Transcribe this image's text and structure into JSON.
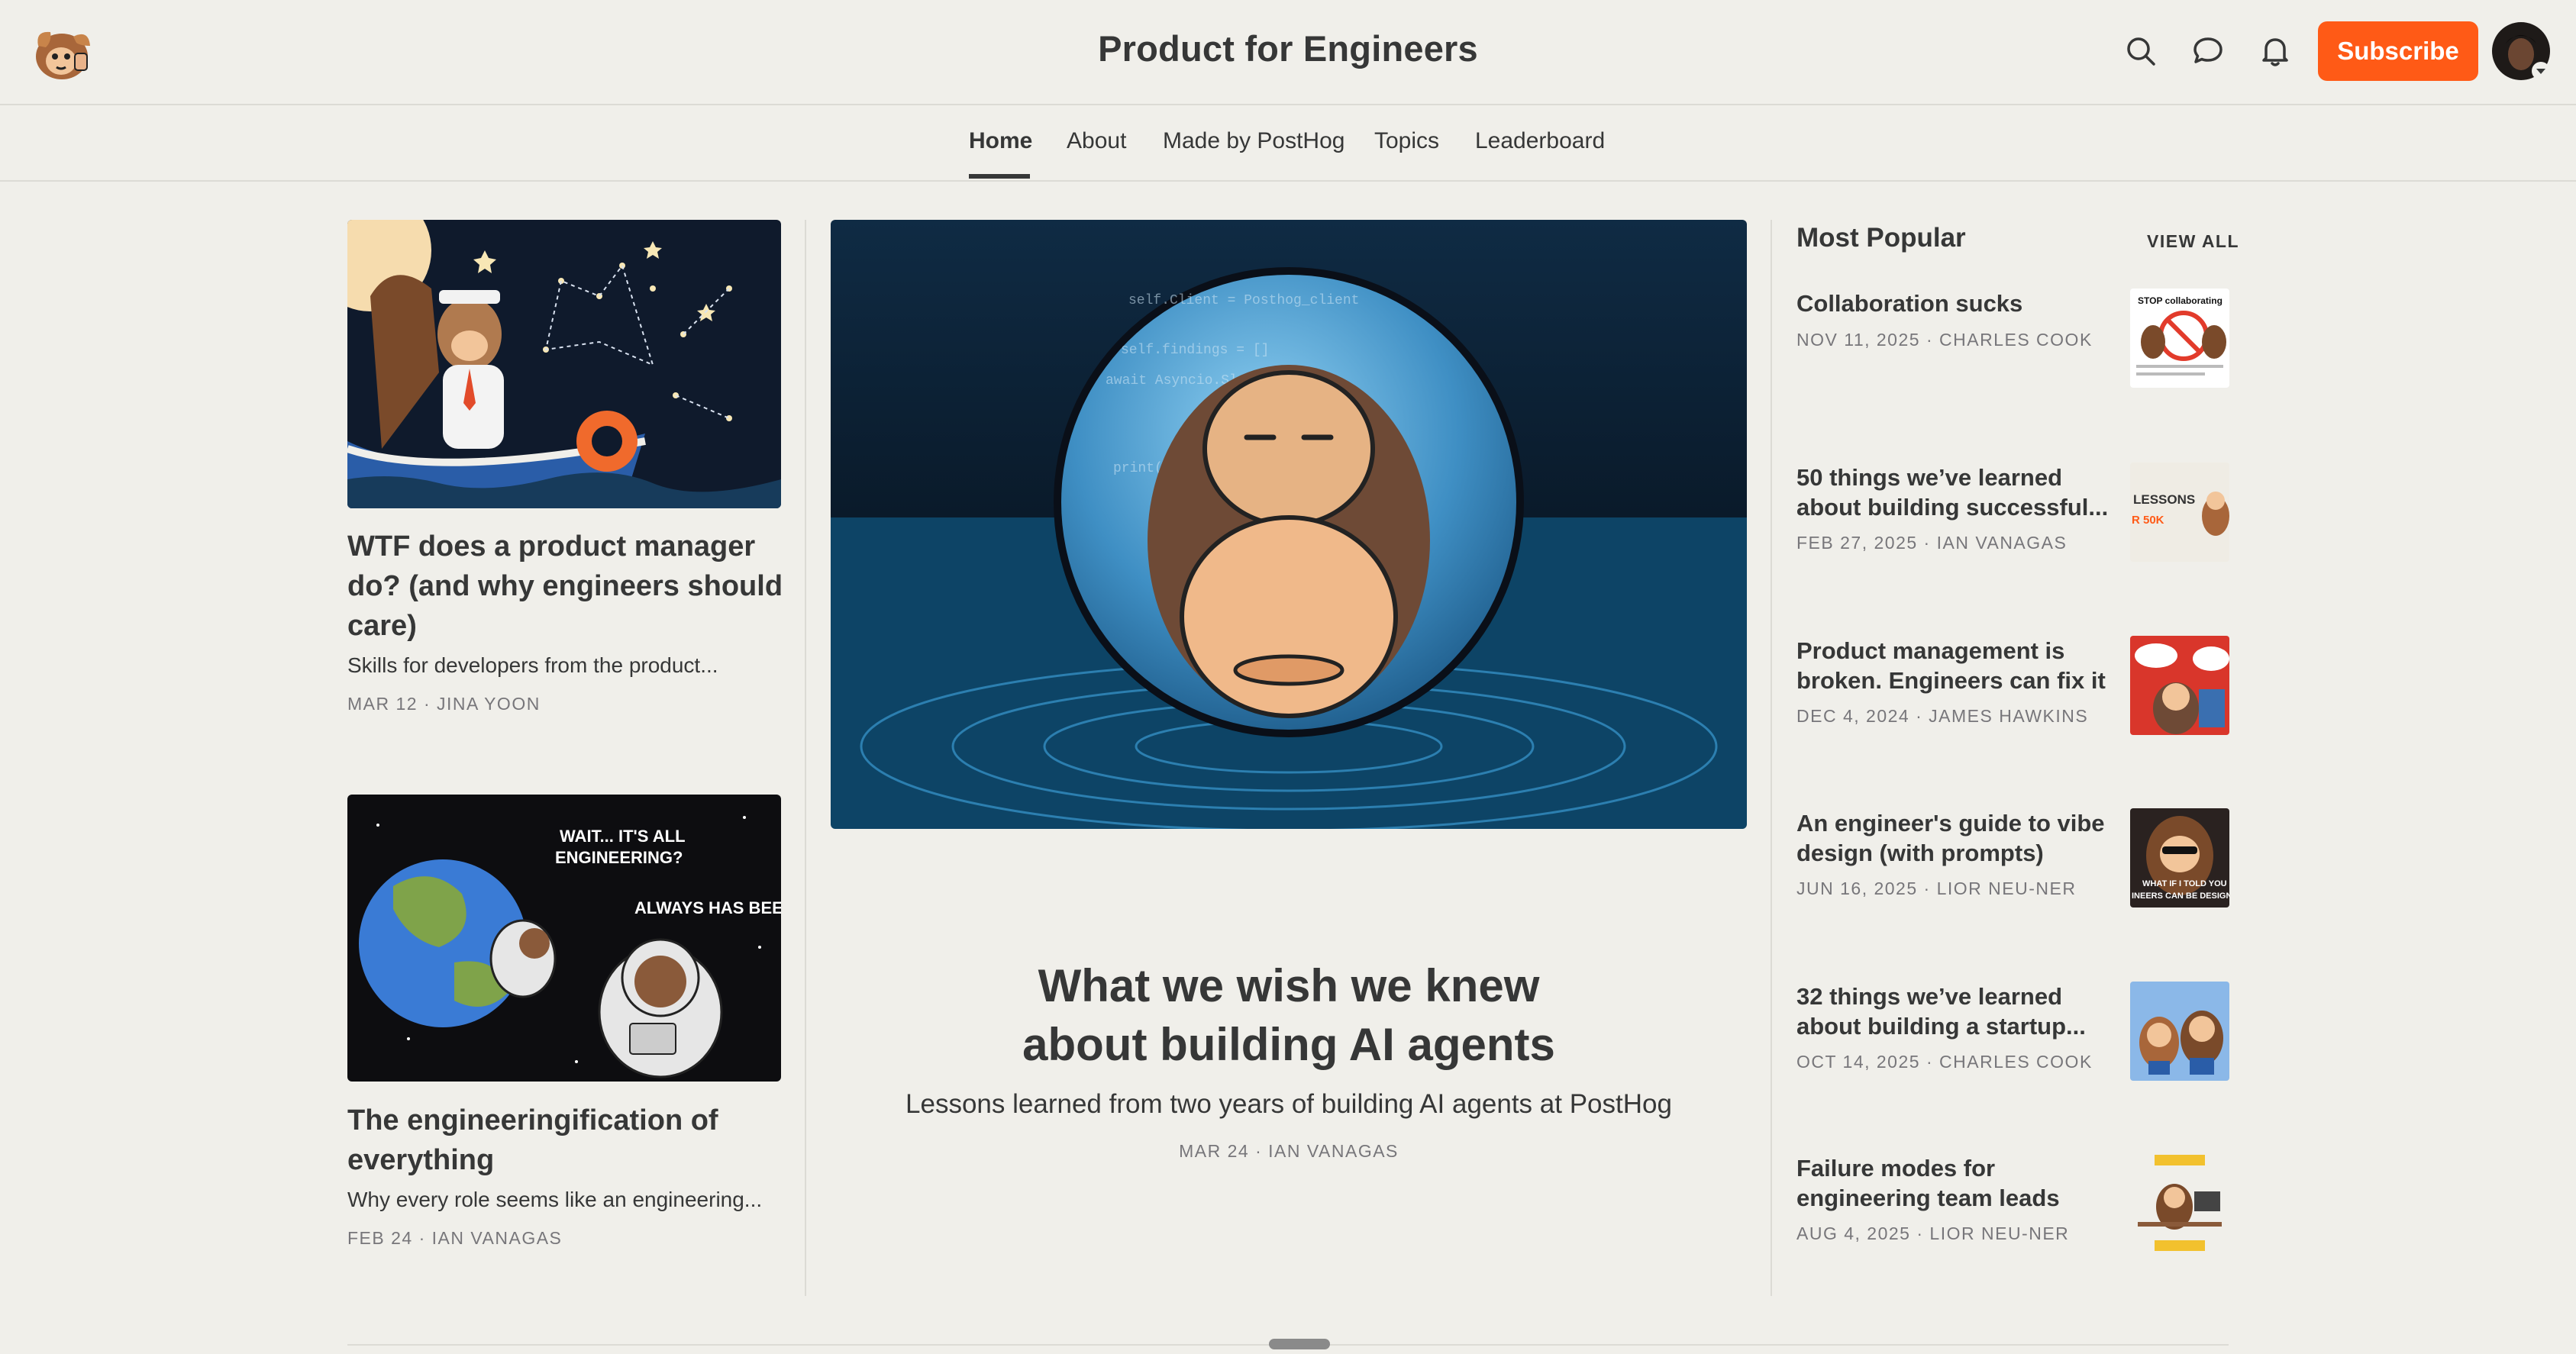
{
  "header": {
    "site_title": "Product for Engineers",
    "subscribe_label": "Subscribe",
    "icons": [
      "search-icon",
      "chat-icon",
      "bell-icon"
    ],
    "accent_color": "#ff5a16"
  },
  "nav": {
    "items": [
      "Home",
      "About",
      "Made by PostHog",
      "Topics",
      "Leaderboard"
    ],
    "active": "Home"
  },
  "left_posts": [
    {
      "title": "WTF does a product manager do? (and why engineers should care)",
      "subtitle": "Skills for developers from the product...",
      "date": "MAR 12",
      "author": "JINA YOON"
    },
    {
      "title": "The engineeringification of everything",
      "subtitle": "Why every role seems like an engineering...",
      "date": "FEB 24",
      "author": "IAN VANAGAS",
      "image_text": [
        "WAIT... IT'S ALL",
        "ENGINEERING?",
        "ALWAYS HAS BEEN"
      ]
    }
  ],
  "featured": {
    "title_line1": "What we wish we knew",
    "title_line2": "about building AI agents",
    "subtitle": "Lessons learned from two years of building AI agents at PostHog",
    "date": "MAR 24",
    "author": "IAN VANAGAS"
  },
  "popular": {
    "heading": "Most Popular",
    "view_all": "VIEW ALL",
    "items": [
      {
        "title": "Collaboration sucks",
        "date": "NOV 11, 2025",
        "author": "CHARLES COOK",
        "thumb_text": "STOP collaborating"
      },
      {
        "title": "50 things we’ve learned about building successful...",
        "date": "FEB 27, 2025",
        "author": "IAN VANAGAS",
        "thumb_text": "LESSONS",
        "thumb_text2": "R 50K"
      },
      {
        "title": "Product management is broken. Engineers can fix it",
        "date": "DEC 4, 2024",
        "author": "JAMES HAWKINS"
      },
      {
        "title": "An engineer's guide to vibe design (with prompts)",
        "date": "JUN 16, 2025",
        "author": "LIOR NEU-NER",
        "thumb_text": "WHAT IF I TOLD YOU",
        "thumb_text2": "INEERS CAN BE DESIGN"
      },
      {
        "title": "32 things we’ve learned about building a startup...",
        "date": "OCT 14, 2025",
        "author": "CHARLES COOK"
      },
      {
        "title": "Failure modes for engineering team leads",
        "date": "AUG 4, 2025",
        "author": "LIOR NEU-NER"
      }
    ]
  },
  "meta_separator": " · "
}
